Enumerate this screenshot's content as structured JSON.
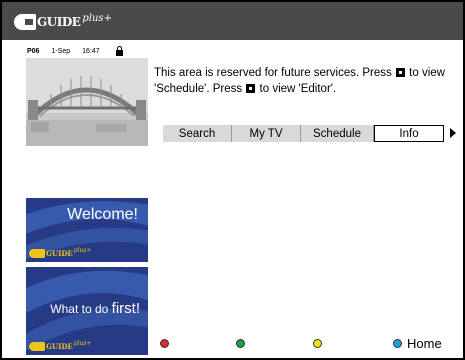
{
  "header": {
    "logo_word": "GUIDE",
    "logo_plus": "plus+"
  },
  "status": {
    "channel": "P06",
    "date": "1-Sep",
    "time": "16:47"
  },
  "info": {
    "part1": "This area is reserved for future services. Press",
    "part2": "to view 'Schedule'.  Press",
    "part3": "to view 'Editor'."
  },
  "tabs": [
    {
      "label": "Search"
    },
    {
      "label": "My TV"
    },
    {
      "label": "Schedule"
    },
    {
      "label": "Info",
      "active": true
    }
  ],
  "cards": {
    "welcome": {
      "text": "Welcome!"
    },
    "first": {
      "text_small": "What to do ",
      "text_big": "first!"
    },
    "logo_word": "GUIDE",
    "logo_plus": "plus+"
  },
  "footer": {
    "home_label": "Home"
  },
  "colors": {
    "red": "#e8242a",
    "green": "#19a048",
    "yellow": "#f3e21a",
    "blue": "#1f9ed8",
    "header": "#4a4a4a",
    "card": "#263a86"
  },
  "icons": [
    "lock-icon",
    "color-button-icon",
    "right-arrow-icon"
  ]
}
